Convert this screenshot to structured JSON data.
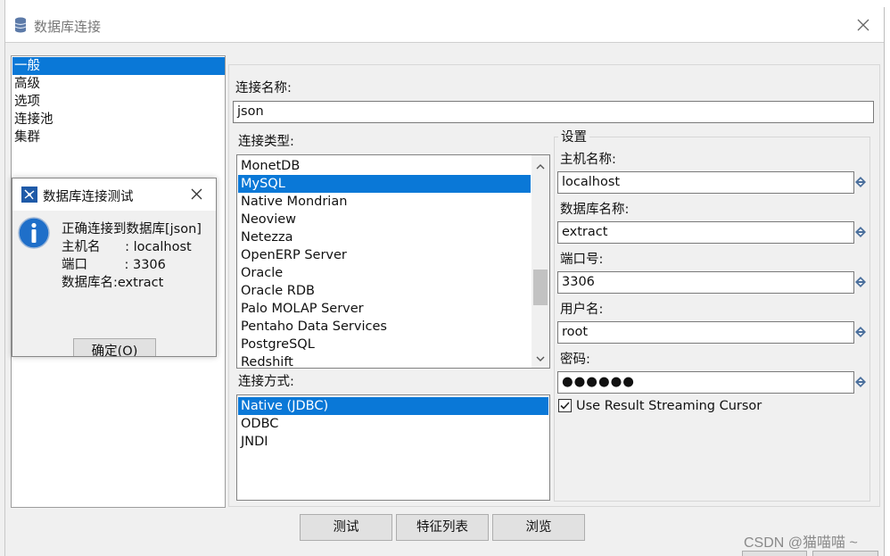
{
  "window": {
    "title": "数据库连接",
    "close_icon": "close-icon"
  },
  "categories": [
    {
      "label": "一般",
      "selected": true
    },
    {
      "label": "高级",
      "selected": false
    },
    {
      "label": "选项",
      "selected": false
    },
    {
      "label": "连接池",
      "selected": false
    },
    {
      "label": "集群",
      "selected": false
    }
  ],
  "general": {
    "connection_name_label": "连接名称:",
    "connection_name_value": "json",
    "connection_type_label": "连接类型:",
    "connection_types": [
      "MonetDB",
      "MySQL",
      "Native Mondrian",
      "Neoview",
      "Netezza",
      "OpenERP Server",
      "Oracle",
      "Oracle RDB",
      "Palo MOLAP Server",
      "Pentaho Data Services",
      "PostgreSQL",
      "Redshift"
    ],
    "connection_type_selected": "MySQL",
    "access_label": "连接方式:",
    "access_methods": [
      "Native (JDBC)",
      "ODBC",
      "JNDI"
    ],
    "access_selected": "Native (JDBC)"
  },
  "settings": {
    "caption": "设置",
    "host_label": "主机名称:",
    "host_value": "localhost",
    "dbname_label": "数据库名称:",
    "dbname_value": "extract",
    "port_label": "端口号:",
    "port_value": "3306",
    "user_label": "用户名:",
    "user_value": "root",
    "password_label": "密码:",
    "password_value": "●●●●●●",
    "streaming_label": "Use Result Streaming Cursor",
    "streaming_checked": true
  },
  "buttons": {
    "test": "测试",
    "feature_list": "特征列表",
    "explore": "浏览"
  },
  "dialog": {
    "title": "数据库连接测试",
    "message_lines": [
      "正确连接到数据库[json]",
      "主机名      : localhost",
      "端口         : 3306",
      "数据库名:extract"
    ],
    "ok_label": "确定(O)"
  },
  "watermark": "CSDN @猫喵喵 ~",
  "colors": {
    "selection": "#0a78d7",
    "dialog_icon": "#1f6fc9"
  }
}
